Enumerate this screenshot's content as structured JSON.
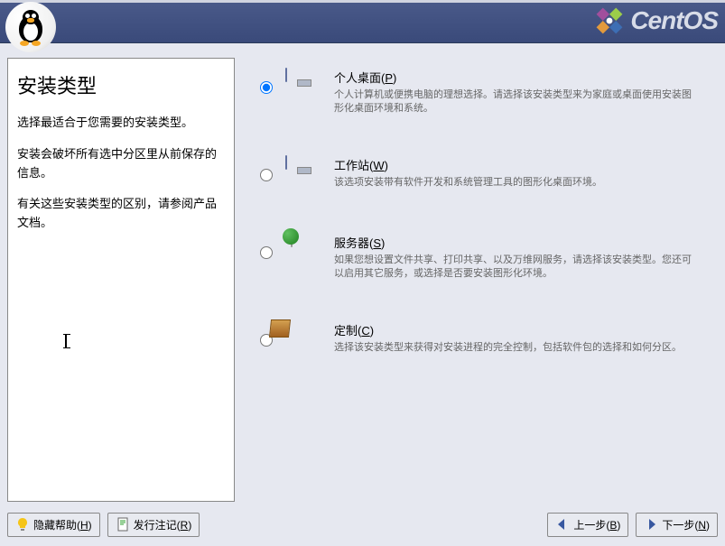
{
  "brand": "CentOS",
  "help": {
    "title": "安装类型",
    "paras": [
      "选择最适合于您需要的安装类型。",
      "安装会破坏所有选中分区里从前保存的信息。",
      "有关这些安装类型的区别，请参阅产品文档。"
    ]
  },
  "options": [
    {
      "id": "personal",
      "label_pre": "个人桌面(",
      "accel": "P",
      "label_post": ")",
      "desc": "个人计算机或便携电脑的理想选择。请选择该安装类型来为家庭或桌面使用安装图形化桌面环境和系统。",
      "checked": true,
      "icon": "monitor"
    },
    {
      "id": "workstation",
      "label_pre": "工作站(",
      "accel": "W",
      "label_post": ")",
      "desc": "该选项安装带有软件开发和系统管理工具的图形化桌面环境。",
      "checked": false,
      "icon": "monitor"
    },
    {
      "id": "server",
      "label_pre": "服务器(",
      "accel": "S",
      "label_post": ")",
      "desc": "如果您想设置文件共享、打印共享、以及万维网服务，请选择该安装类型。您还可以启用其它服务，或选择是否要安装图形化环境。",
      "checked": false,
      "icon": "server"
    },
    {
      "id": "custom",
      "label_pre": "定制(",
      "accel": "C",
      "label_post": ")",
      "desc": "选择该安装类型来获得对安装进程的完全控制，包括软件包的选择和如何分区。",
      "checked": false,
      "icon": "custom"
    }
  ],
  "buttons": {
    "hide_help_pre": "隐藏帮助(",
    "hide_help_accel": "H",
    "hide_help_post": ")",
    "release_notes_pre": "发行注记(",
    "release_notes_accel": "R",
    "release_notes_post": ")",
    "back_pre": "上一步(",
    "back_accel": "B",
    "back_post": ")",
    "next_pre": "下一步(",
    "next_accel": "N",
    "next_post": ")"
  }
}
